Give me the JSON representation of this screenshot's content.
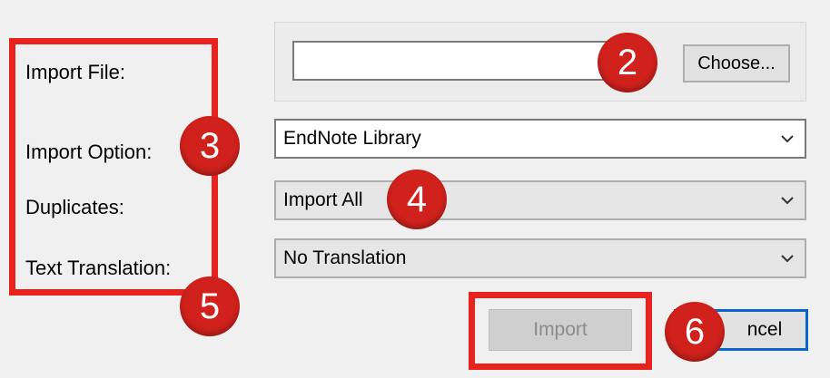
{
  "labels": {
    "import_file": "Import File:",
    "import_option": "Import Option:",
    "duplicates": "Duplicates:",
    "text_translation": "Text Translation:"
  },
  "import_file": {
    "value": "",
    "choose_label": "Choose..."
  },
  "import_option": {
    "selected": "EndNote Library"
  },
  "duplicates": {
    "selected": "Import All"
  },
  "text_translation": {
    "selected": "No Translation"
  },
  "buttons": {
    "import_label": "Import",
    "cancel_label": "ncel"
  },
  "badges": [
    "2",
    "3",
    "4",
    "5",
    "6"
  ],
  "colors": {
    "highlight_red": "#e8231e",
    "badge_red": "#d0211c",
    "default_button_border": "#0a64c9"
  }
}
